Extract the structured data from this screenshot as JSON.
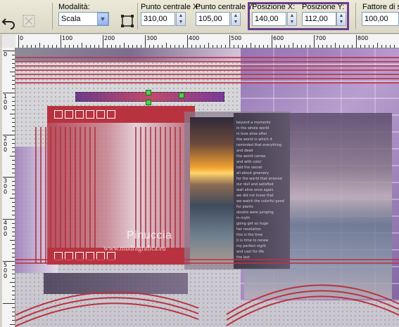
{
  "toolbar": {
    "modalita_label": "Modalità:",
    "modalita_value": "Scala",
    "centro_x_label": "Punto centrale X:",
    "centro_x_value": "310,00",
    "centro_y_label": "Punto centrale Y:",
    "centro_y_value": "105,00",
    "pos_x_label": "Posizione X:",
    "pos_x_value": "140,00",
    "pos_y_label": "Posizione Y:",
    "pos_y_value": "112,00",
    "fattore_label": "Fattore di sca",
    "fattore_value": "100,00",
    "highlight_color": "#6a3d8e"
  },
  "ruler": {
    "top_labels": [
      "0",
      "100",
      "200",
      "300",
      "400",
      "500",
      "600",
      "700",
      "800"
    ],
    "left_labels": [
      "0",
      "1\n0\n0",
      "2\n0\n0",
      "3\n0\n0",
      "4\n0\n0",
      "5\n0\n0"
    ]
  },
  "canvas": {
    "watermark_name": "Pinuccia",
    "watermark_url": "www.mudragrafica.eu",
    "poem_lines": [
      "beyond a moments",
      "in the whole world",
      "in love alive after",
      "the world in which it",
      "reminded that everything",
      "and dead",
      "the world comes",
      "and with color",
      "told the secret",
      "all about greenery",
      "for the world that entered",
      "our dull and satisfied",
      "wall alive once again",
      "we did not know that",
      "we watch the colorful good",
      "for plants",
      "doubts were jumping",
      "in myth",
      "going get so huge",
      "her revelation",
      "this is the time",
      "it is time to renew",
      "my perfect night",
      "and cast for life",
      "the last"
    ],
    "accent_red": "#b8333f",
    "accent_purple": "#8e6fb0"
  }
}
